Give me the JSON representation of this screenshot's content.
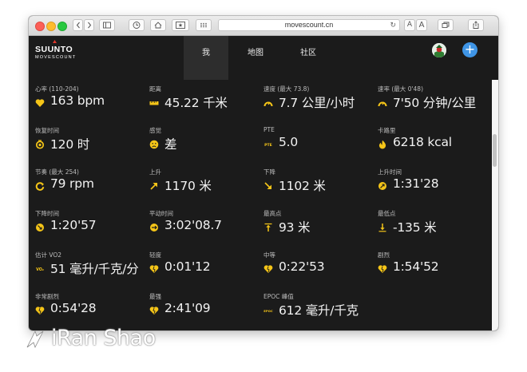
{
  "browser": {
    "url": "movescount.cn",
    "reader_a_small": "A",
    "reader_a_large": "A"
  },
  "header": {
    "brand": "SUUNTO",
    "brand_sub": "MOVESCOUNT",
    "nav": [
      {
        "label": "我",
        "active": true
      },
      {
        "label": "地图",
        "active": false
      },
      {
        "label": "社区",
        "active": false
      }
    ],
    "add_button": "+"
  },
  "metrics": [
    {
      "label": "心率 (110-204)",
      "value": "163 bpm",
      "icon": "heart-icon"
    },
    {
      "label": "距离",
      "value": "45.22 千米",
      "icon": "ruler-icon"
    },
    {
      "label": "速度 (最大 73.8)",
      "value": "7.7 公里/小时",
      "icon": "speedometer-icon"
    },
    {
      "label": "速率 (最大 0'48)",
      "value": "7'50 分钟/公里",
      "icon": "pace-gauge-icon"
    },
    {
      "label": "恢复时间",
      "value": "120 时",
      "icon": "recovery-clock-icon"
    },
    {
      "label": "感觉",
      "value": "差",
      "icon": "sad-face-icon"
    },
    {
      "label": "PTE",
      "value": "5.0",
      "icon": "pte-icon"
    },
    {
      "label": "卡路里",
      "value": "6218 kcal",
      "icon": "flame-icon"
    },
    {
      "label": "节奏 (最大 254)",
      "value": "79 rpm",
      "icon": "cadence-icon"
    },
    {
      "label": "上升",
      "value": "1170 米",
      "icon": "arrow-up-right-icon"
    },
    {
      "label": "下降",
      "value": "1102 米",
      "icon": "arrow-down-right-icon"
    },
    {
      "label": "上升时间",
      "value": "1:31'28",
      "icon": "ascent-time-icon"
    },
    {
      "label": "下降时间",
      "value": "1:20'57",
      "icon": "descent-time-icon"
    },
    {
      "label": "平动时间",
      "value": "3:02'08.7",
      "icon": "flat-time-icon"
    },
    {
      "label": "最高点",
      "value": "93 米",
      "icon": "highest-point-icon"
    },
    {
      "label": "最低点",
      "value": "-135 米",
      "icon": "lowest-point-icon"
    },
    {
      "label": "估计 VO2",
      "value": "51 毫升/千克/分",
      "icon": "vo2-icon"
    },
    {
      "label": "轻度",
      "value": "0:01'12",
      "icon": "heart-zone-light-icon"
    },
    {
      "label": "中等",
      "value": "0:22'53",
      "icon": "heart-zone-moderate-icon"
    },
    {
      "label": "剧烈",
      "value": "1:54'52",
      "icon": "heart-zone-hard-icon"
    },
    {
      "label": "非常剧烈",
      "value": "0:54'28",
      "icon": "heart-zone-very-hard-icon"
    },
    {
      "label": "最强",
      "value": "2:41'09",
      "icon": "heart-zone-max-icon"
    },
    {
      "label": "EPOC 峰值",
      "value": "612 毫升/千克",
      "icon": "epoc-icon"
    }
  ],
  "icon_texts": {
    "pte": "PTE",
    "vo2": "VO₂",
    "epoc": "EPOC"
  },
  "colors": {
    "accent": "#f5c518",
    "background": "#1b1b1b",
    "plus": "#3f95e6"
  },
  "watermark": "iRan Shao"
}
